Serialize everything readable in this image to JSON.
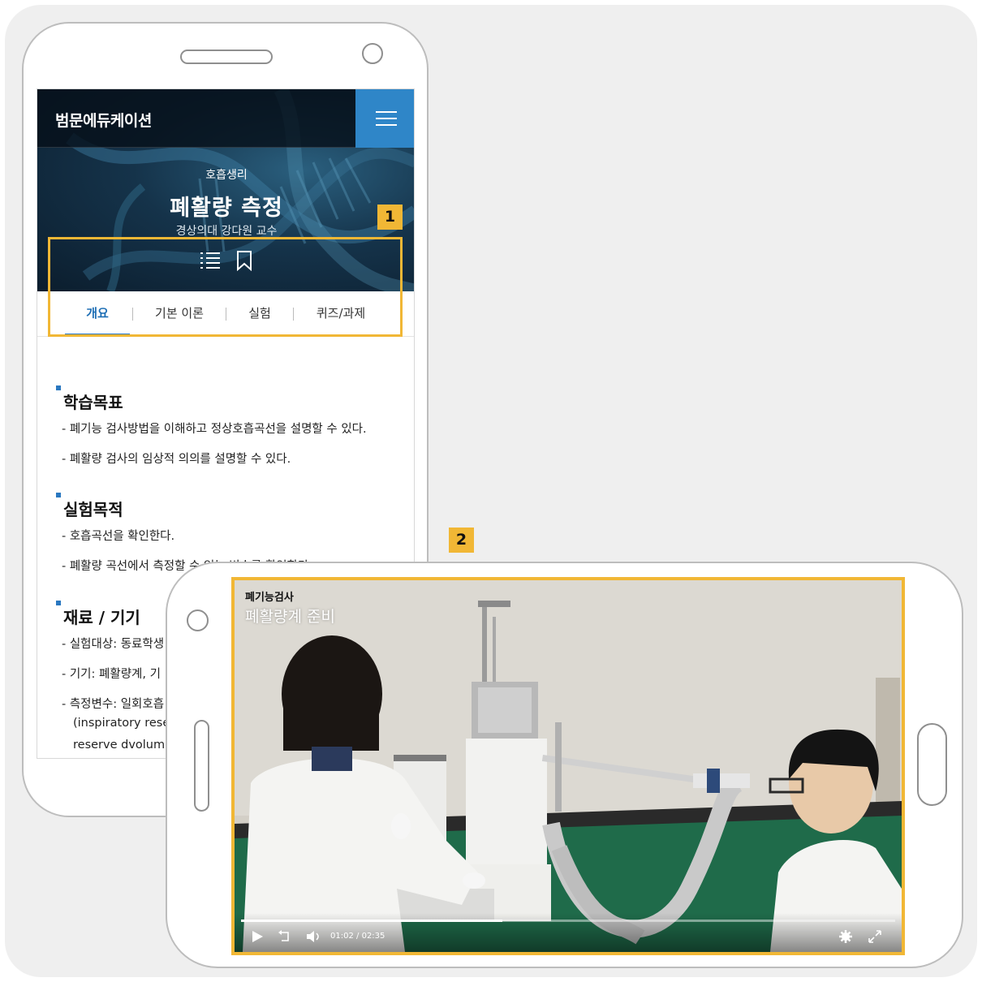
{
  "portrait": {
    "brand": "범문에듀케이션",
    "header": {
      "category": "호흡생리",
      "title": "폐활량 측정",
      "professor": "경상의대 강다원 교수"
    },
    "tabs": [
      {
        "label": "개요",
        "active": true
      },
      {
        "label": "기본 이론",
        "active": false
      },
      {
        "label": "실험",
        "active": false
      },
      {
        "label": "퀴즈/과제",
        "active": false
      }
    ],
    "sections": [
      {
        "heading": "학습목표",
        "items": [
          "- 폐기능 검사방법을 이해하고 정상호흡곡선을 설명할 수 있다.",
          "- 폐활량 검사의 임상적 의의를 설명할 수 있다."
        ]
      },
      {
        "heading": "실험목적",
        "items": [
          "- 호흡곡선을 확인한다.",
          "- 폐활량 곡선에서 측정할 수 있는 변수를 확인한다."
        ]
      },
      {
        "heading": "재료 / 기기",
        "items": [
          "- 실험대상: 동료학생",
          "- 기기: 폐활량계, 기",
          "- 측정변수: 일회호흡",
          "(inspiratory reser",
          "reserve dvolume"
        ]
      }
    ]
  },
  "callouts": {
    "one": "1",
    "two": "2"
  },
  "video": {
    "caption_top": "폐기능검사",
    "caption_main": "폐활량계 준비",
    "current_time": "01:02",
    "separator": "/",
    "duration": "02:35",
    "progress_fraction": 0.4
  },
  "colors": {
    "accent_blue": "#2a78c0",
    "menu_blue": "#2f86c8",
    "callout_yellow": "#f1b735"
  },
  "icons": [
    "hamburger-menu-icon",
    "list-icon",
    "bookmark-icon",
    "play-icon",
    "replay-10-icon",
    "volume-icon",
    "settings-icon",
    "fullscreen-icon"
  ]
}
